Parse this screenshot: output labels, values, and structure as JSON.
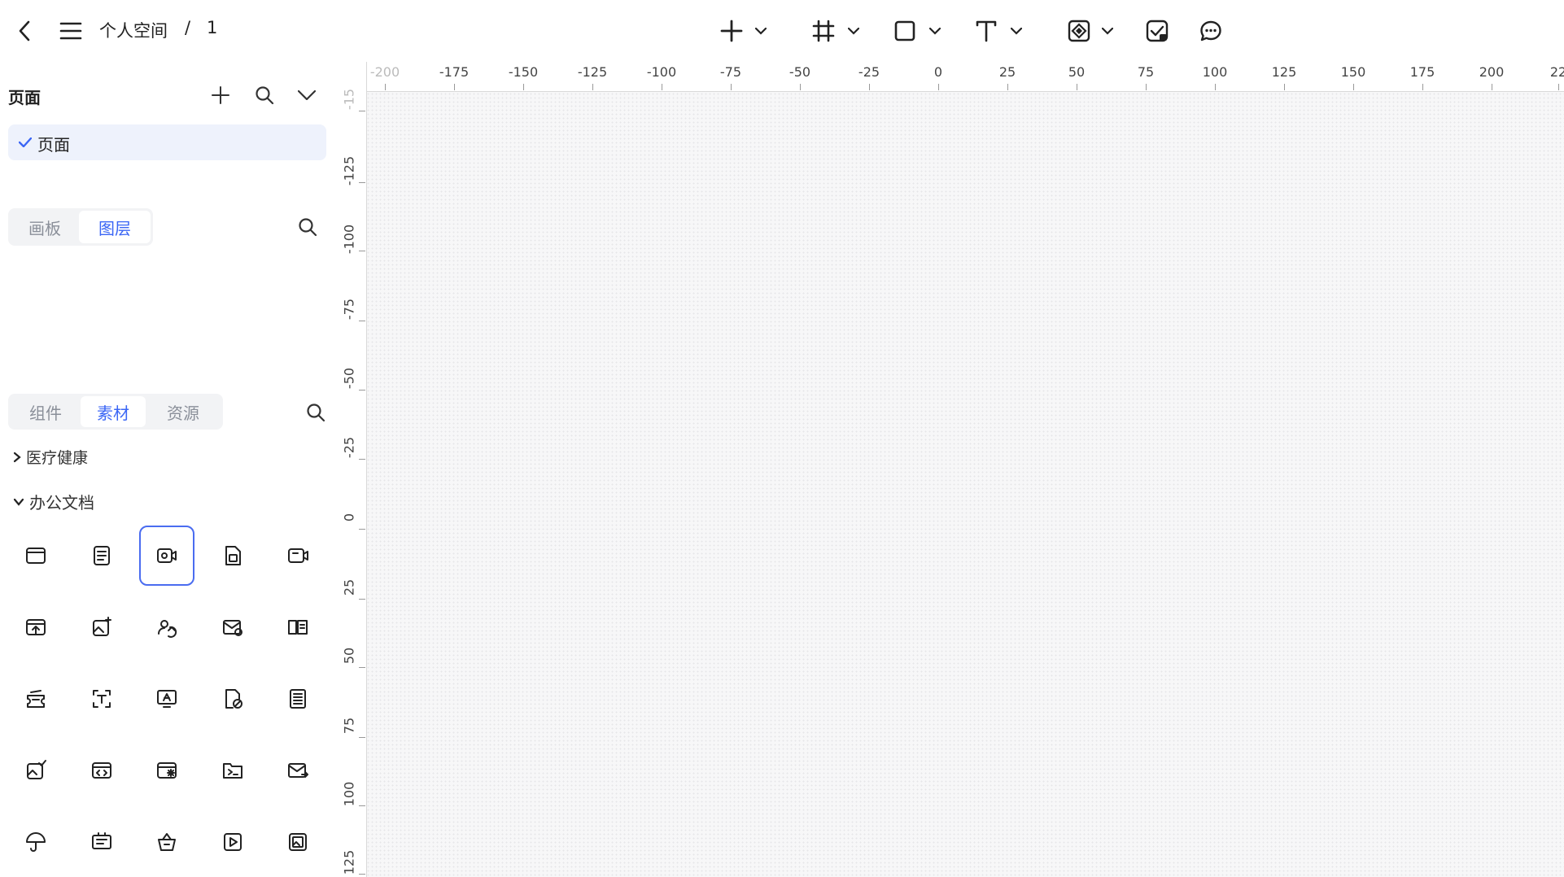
{
  "header": {
    "breadcrumb_space": "个人空间",
    "breadcrumb_sep": "/",
    "breadcrumb_file": "1"
  },
  "pages_panel": {
    "title": "页面",
    "pages": [
      {
        "label": "页面",
        "selected": true
      }
    ]
  },
  "layers_panel": {
    "tabs": [
      {
        "label": "画板",
        "active": false
      },
      {
        "label": "图层",
        "active": true
      }
    ]
  },
  "assets_panel": {
    "tabs": [
      {
        "label": "组件",
        "active": false
      },
      {
        "label": "素材",
        "active": true
      },
      {
        "label": "资源",
        "active": false
      }
    ],
    "categories": [
      {
        "label": "医疗健康",
        "expanded": false
      },
      {
        "label": "办公文档",
        "expanded": true
      }
    ],
    "icons": [
      [
        "browser-window-icon",
        "document-list-icon",
        "video-document-icon",
        "file-image-icon",
        "video-camera-icon"
      ],
      [
        "window-upload-icon",
        "image-sparkle-icon",
        "user-sync-icon",
        "mail-clock-icon",
        "book-list-icon"
      ],
      [
        "ticket-stack-icon",
        "text-scan-icon",
        "image-text-icon",
        "file-blocked-icon",
        "list-document-icon"
      ],
      [
        "image-check-icon",
        "window-code-icon",
        "window-star-icon",
        "folder-terminal-icon",
        "mail-forward-icon"
      ],
      [
        "umbrella-icon",
        "card-text-icon",
        "basket-icon",
        "play-box-icon",
        "image-box-icon"
      ]
    ],
    "selected_icon": "video-document-icon"
  },
  "ruler": {
    "top_ticks": [
      "-200",
      "-175",
      "-150",
      "-125",
      "-100",
      "-75",
      "-50",
      "-25",
      "0",
      "25",
      "50",
      "75",
      "100",
      "125",
      "150",
      "175",
      "200",
      "22"
    ],
    "left_ticks": [
      "-15",
      "-125",
      "-100",
      "-75",
      "-50",
      "-25",
      "0",
      "25",
      "50",
      "75",
      "100",
      "125"
    ]
  },
  "colors": {
    "accent": "#3b66f5",
    "selection_bg": "#eef2fc",
    "canvas": "#f7f7f8"
  }
}
